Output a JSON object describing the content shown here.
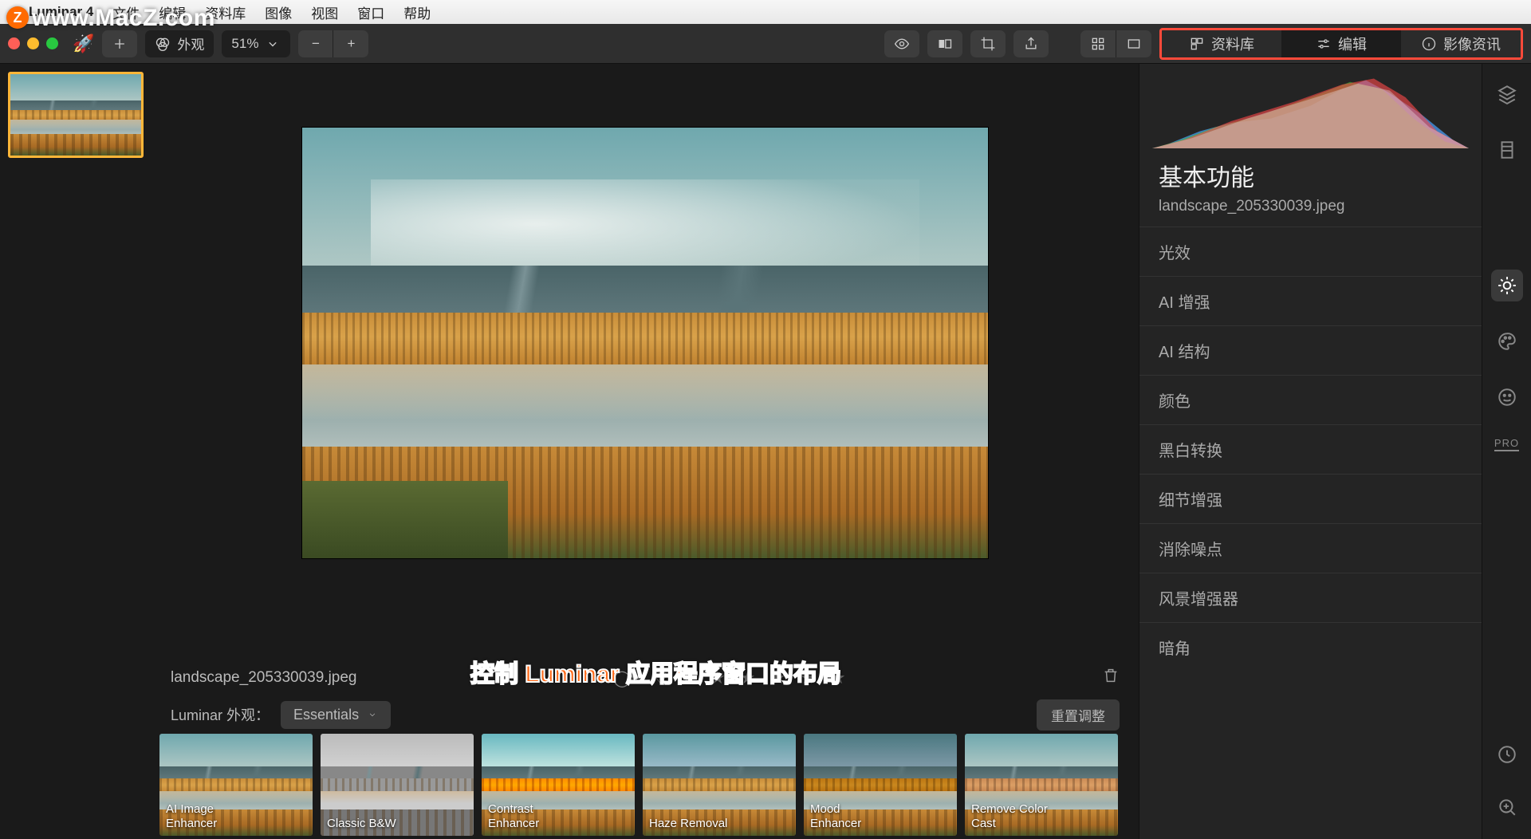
{
  "watermark": "www.MacZ.com",
  "menubar": {
    "app": "Luminar 4",
    "items": [
      "文件",
      "编辑",
      "资料库",
      "图像",
      "视图",
      "窗口",
      "帮助"
    ]
  },
  "toolbar": {
    "appearance_label": "外观",
    "zoom": "51%",
    "mode_tabs": {
      "library": "资料库",
      "edit": "编辑",
      "info": "影像资讯"
    }
  },
  "filename": "landscape_205330039.jpeg",
  "looks": {
    "prefix": "Luminar 外观：",
    "category": "Essentials",
    "reset": "重置调整",
    "items": [
      "AI Image\nEnhancer",
      "Classic B&W",
      "Contrast\nEnhancer",
      "Haze Removal",
      "Mood\nEnhancer",
      "Remove Color\nCast"
    ]
  },
  "caption": "控制 Luminar 应用程序窗口的布局",
  "panel": {
    "title": "基本功能",
    "filename": "landscape_205330039.jpeg",
    "items": [
      "光效",
      "AI 增强",
      "AI 结构",
      "颜色",
      "黑白转换",
      "细节增强",
      "消除噪点",
      "风景增强器",
      "暗角"
    ]
  },
  "rail": {
    "pro": "PRO"
  }
}
